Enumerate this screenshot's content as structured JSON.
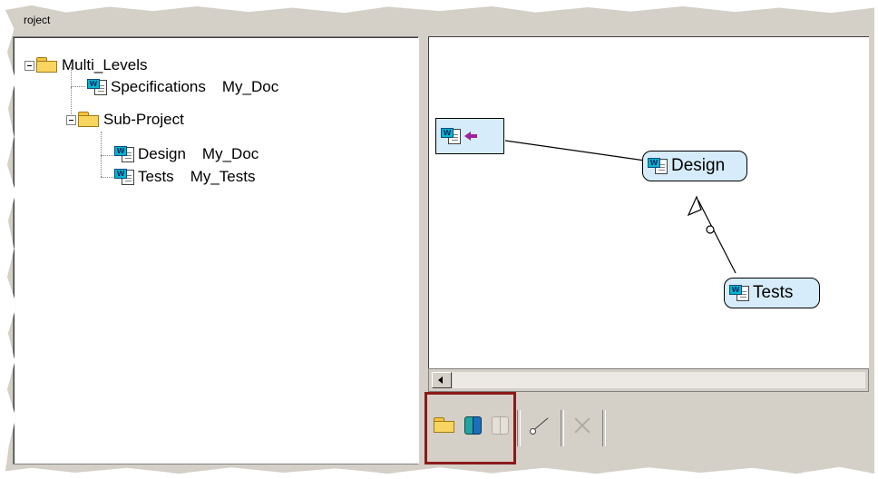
{
  "window": {
    "title": "roject"
  },
  "tree": {
    "items": [
      {
        "label": "Multi_Levels",
        "extra": "",
        "type": "folder"
      },
      {
        "label": "Specifications",
        "extra": "My_Doc",
        "type": "document"
      },
      {
        "label": "Sub-Project",
        "extra": "",
        "type": "folder"
      },
      {
        "label": "Design",
        "extra": "My_Doc",
        "type": "document"
      },
      {
        "label": "Tests",
        "extra": "My_Tests",
        "type": "document"
      }
    ]
  },
  "diagram": {
    "nodes": [
      {
        "label": "Design",
        "icon": "word-document-icon"
      },
      {
        "label": "Tests",
        "icon": "word-document-icon"
      }
    ],
    "source_node": {
      "icon": "word-document-icon",
      "arrow_icon": "arrow-left-icon",
      "arrow_color": "#a020a0"
    },
    "node_fill": "#d6ecfb"
  },
  "toolbar": {
    "buttons": [
      {
        "icon": "open-folder-icon",
        "enabled": true
      },
      {
        "icon": "book-icon",
        "enabled": true
      },
      {
        "icon": "book-icon",
        "enabled": false
      },
      {
        "icon": "link-icon",
        "enabled": true
      },
      {
        "icon": "close-x-icon",
        "enabled": false
      }
    ],
    "highlight_color": "#8b1a1a"
  }
}
